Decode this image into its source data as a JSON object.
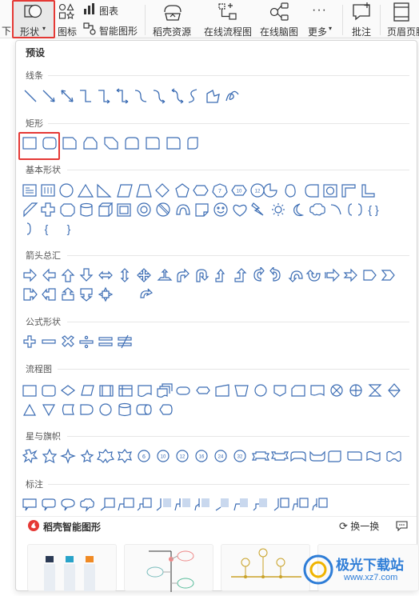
{
  "toolbar": {
    "cut_left_label": "下",
    "shapes_label": "形状",
    "icons_label": "图标",
    "chart_label": "图表",
    "smart_shape_label": "智能图形",
    "docer_resources_label": "稻壳资源",
    "online_flowchart_label": "在线流程图",
    "online_mindmap_label": "在线脑图",
    "more_label": "更多",
    "comment_label": "批注",
    "header_footer_label": "页眉页脚"
  },
  "panel": {
    "preset_title": "预设",
    "sections": [
      {
        "title": "线条"
      },
      {
        "title": "矩形"
      },
      {
        "title": "基本形状"
      },
      {
        "title": "箭头总汇"
      },
      {
        "title": "公式形状"
      },
      {
        "title": "流程图"
      },
      {
        "title": "星与旗帜"
      },
      {
        "title": "标注"
      }
    ],
    "basic_text_glyphs": [
      "{",
      "}",
      "{",
      "}"
    ],
    "stars_numbers": [
      "6",
      "10",
      "12",
      "16",
      "24",
      "32"
    ]
  },
  "footer": {
    "title": "稻壳智能图形",
    "swap_label": "换一换"
  },
  "watermark": {
    "text": "极光下载站",
    "url": "www.xz7.com"
  },
  "colors": {
    "shape_stroke": "#3b6cb3",
    "highlight": "#e53935",
    "brand_red": "#e53935"
  }
}
